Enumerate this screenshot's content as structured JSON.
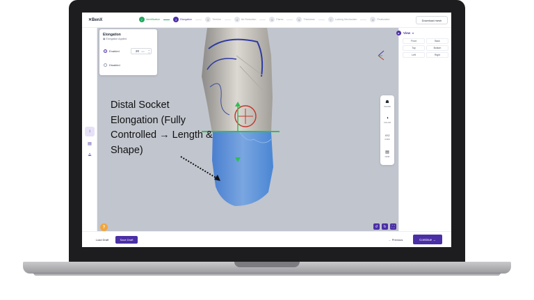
{
  "app": {
    "logo": "✕BenX",
    "download_label": "Download mesh"
  },
  "steps": [
    {
      "num": "✓",
      "label": "Identification",
      "state": "done"
    },
    {
      "num": "2",
      "label": "Elongation",
      "state": "active"
    },
    {
      "num": "3",
      "label": "Trimline",
      "state": "todo"
    },
    {
      "num": "4",
      "label": "Air Reduction",
      "state": "todo"
    },
    {
      "num": "5",
      "label": "Flares",
      "state": "todo"
    },
    {
      "num": "6",
      "label": "Thickness",
      "state": "todo"
    },
    {
      "num": "7",
      "label": "Locking Mechanism",
      "state": "todo"
    },
    {
      "num": "8",
      "label": "Finalization",
      "state": "todo"
    }
  ],
  "card": {
    "title": "Elongation",
    "subtitle": "▣ Elongation Applied",
    "enabled_label": "Enabled",
    "disabled_label": "Disabled",
    "value": "20",
    "unit": "mm"
  },
  "view": {
    "label": "View",
    "buttons": [
      "Front",
      "Back",
      "Top",
      "Bottom",
      "Left",
      "Right"
    ]
  },
  "float_tools": [
    {
      "icon": "☗",
      "label": "SHADE"
    },
    {
      "icon": "◑",
      "label": "COLOR"
    },
    {
      "icon": "XYZ",
      "label": "AXES"
    },
    {
      "icon": "▤",
      "label": "GRID"
    }
  ],
  "bottom": {
    "load_label": "Load Draft",
    "save_label": "Save Draft",
    "prev_label": "← Previous",
    "continue_label": "Continue →"
  },
  "help_label": "?",
  "annotation": "Distal Socket Elongation (Fully Controlled → Length & Shape)",
  "colors": {
    "accent": "#4b2fa6",
    "success": "#22a860",
    "viewport": "#c1c5ce",
    "mesh_blue": "#4a86d4"
  }
}
